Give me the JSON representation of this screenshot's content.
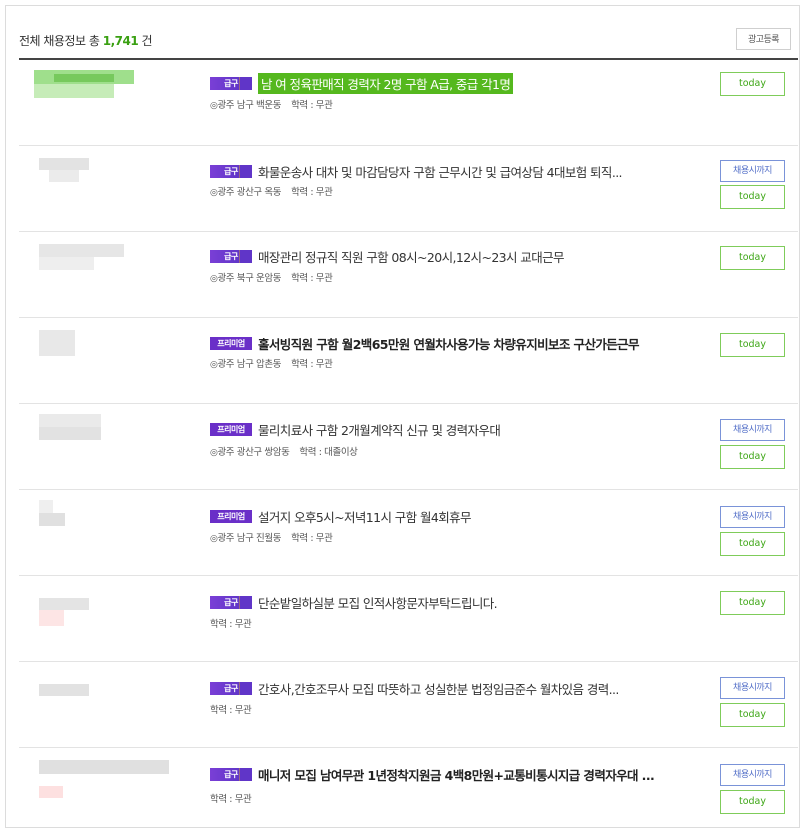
{
  "header": {
    "prefix": "전체 채용정보 총",
    "count": "1,741",
    "suffix": "건",
    "ad_button": "광고등록"
  },
  "labels": {
    "deadline": "채용시까지",
    "today": "today"
  },
  "listings": [
    {
      "badge": "급구",
      "title": "남 여 정육판매직 경력자 2명 구함 A급, 중급 각1명",
      "location": "광주 남구 백운동",
      "edu": "학력 : 무관"
    },
    {
      "badge": "급구",
      "title": "화물운송사 대차 및 마감담당자 구함 근무시간 및 급여상담 4대보험 퇴직...",
      "location": "광주 광산구 옥동",
      "edu": "학력 : 무관"
    },
    {
      "badge": "급구",
      "title": "매장관리 정규직 직원 구함 08시~20시,12시~23시 교대근무",
      "location": "광주 북구 운암동",
      "edu": "학력 : 무관"
    },
    {
      "badge": "프리미엄",
      "title": "홀서빙직원 구함 월2백65만원 연월차사용가능 차량유지비보조 구산가든근무",
      "location": "광주 남구 압촌동",
      "edu": "학력 : 무관"
    },
    {
      "badge": "프리미엄",
      "title": "물리치료사 구함 2개월계약직 신규 및 경력자우대",
      "location": "광주 광산구 쌍암동",
      "edu": "학력 : 대졸이상"
    },
    {
      "badge": "프리미엄",
      "title": "설거지 오후5시~저녁11시 구함 월4회휴무",
      "location": "광주 남구 진월동",
      "edu": "학력 : 무관"
    },
    {
      "badge": "급구",
      "title": "단순밭일하실분 모집 인적사항문자부탁드립니다.",
      "edu": "학력 : 무관"
    },
    {
      "badge": "급구",
      "title": "간호사,간호조무사 모집 따뜻하고 성실한분 법정임금준수 월차있음 경력...",
      "edu": "학력 : 무관"
    },
    {
      "badge": "급구",
      "title": "매니저 모집 남여무관 1년정착지원금 4백8만원+교통비통시지급 경력자우대 ...",
      "edu": "학력 : 무관"
    }
  ]
}
